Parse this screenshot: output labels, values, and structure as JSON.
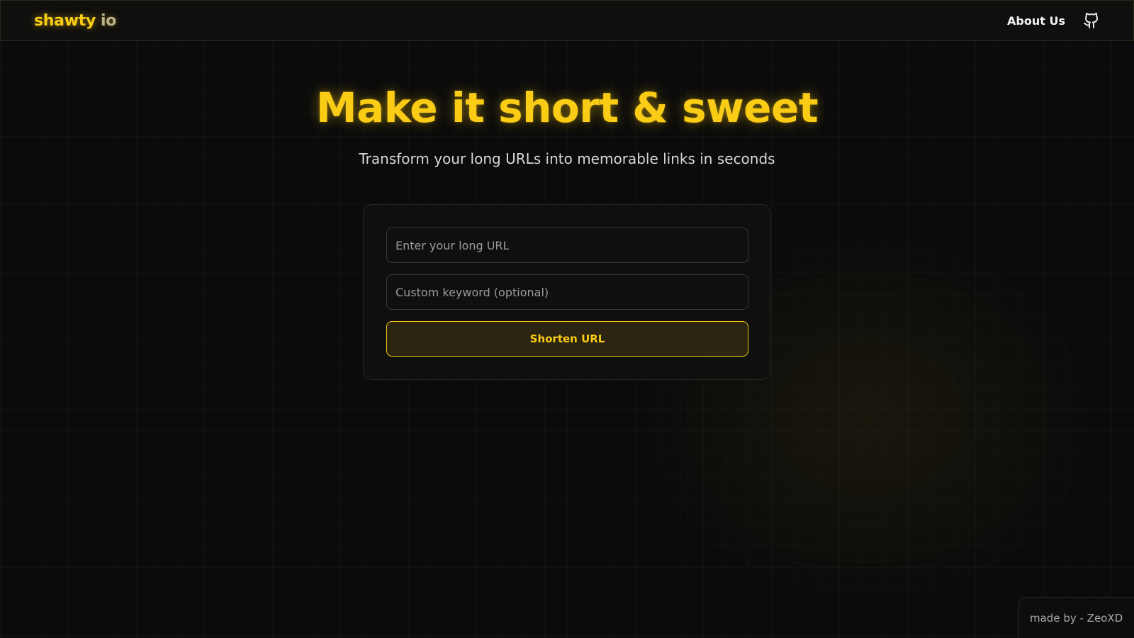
{
  "navbar": {
    "brand_main": "shawty",
    "brand_suffix": "io",
    "about_label": "About Us",
    "github_icon": "github-icon"
  },
  "hero": {
    "title": "Make it short & sweet",
    "subtitle": "Transform your long URLs into memorable links in seconds"
  },
  "form": {
    "url_placeholder": "Enter your long URL",
    "url_value": "",
    "keyword_placeholder": "Custom keyword (optional)",
    "keyword_value": "",
    "submit_label": "Shorten URL"
  },
  "footer": {
    "credit": "made by - ZeoXD"
  },
  "colors": {
    "accent": "#facc15",
    "background": "#0b0b0b"
  }
}
